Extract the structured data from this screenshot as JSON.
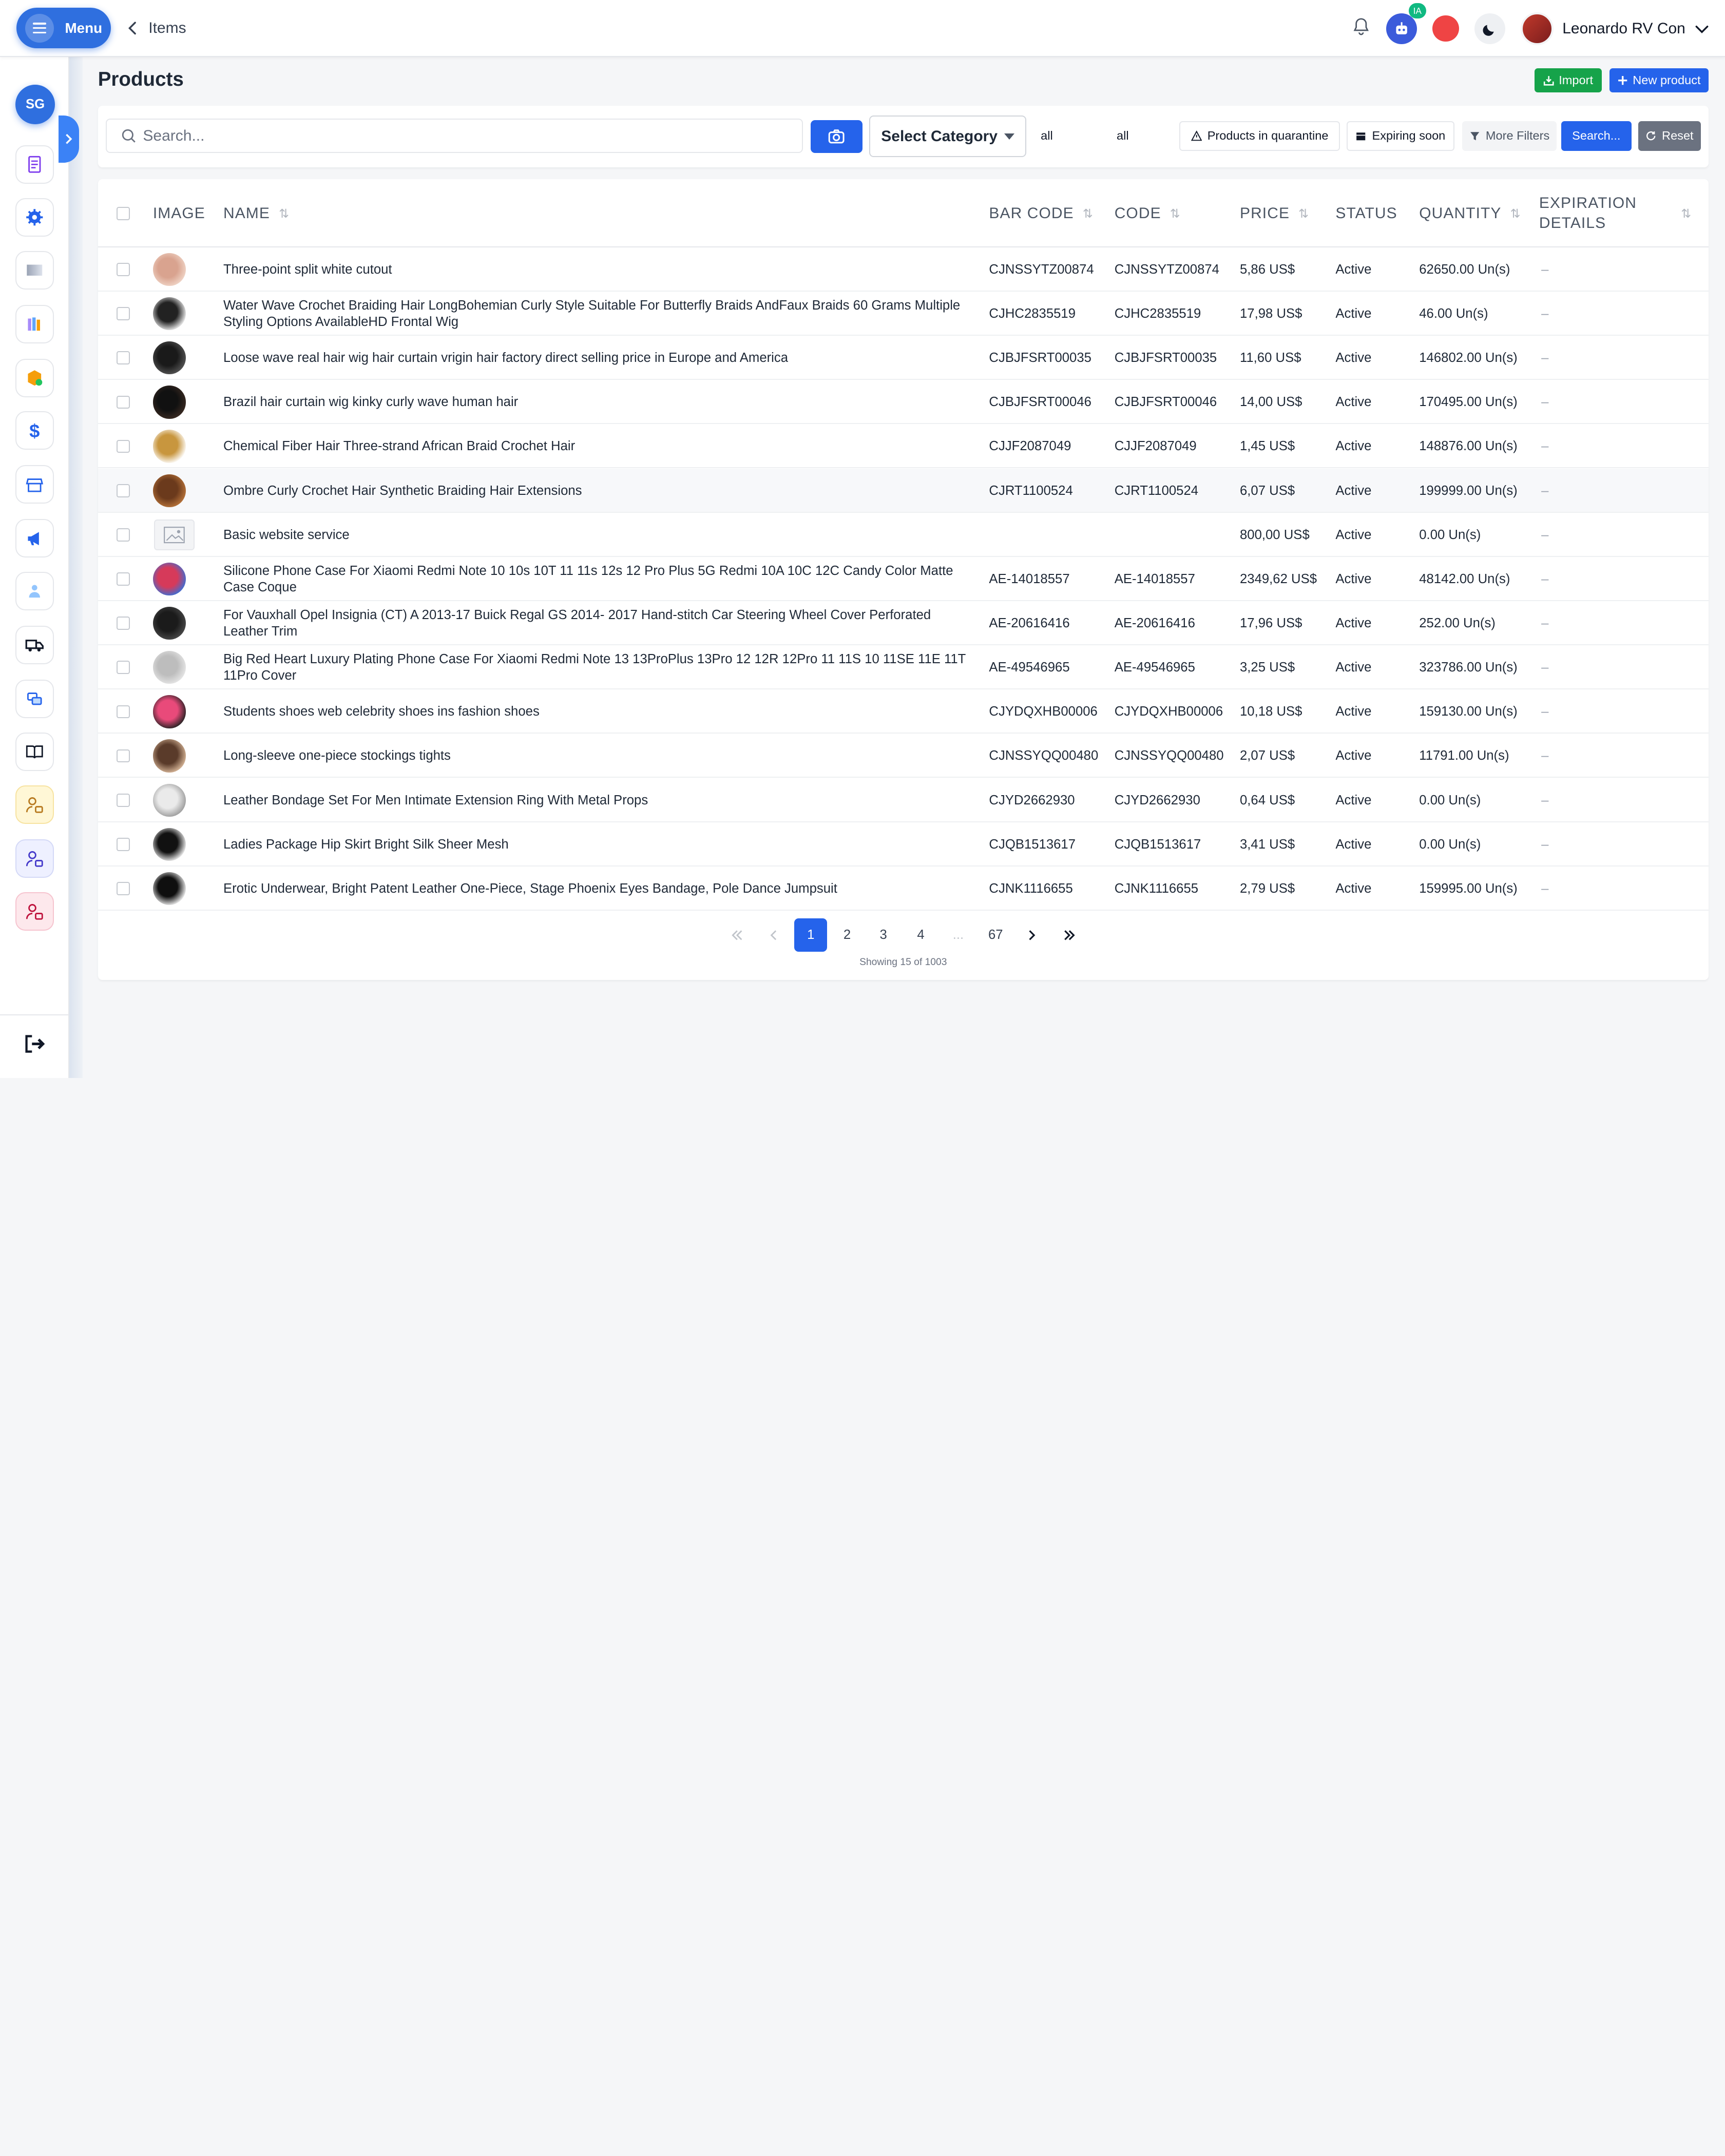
{
  "header": {
    "menu_label": "Menu",
    "back_label": "Items",
    "ia_badge": "IA",
    "user_name": "Leonardo RV Con"
  },
  "sidebar": {
    "org_initials": "SG",
    "items": [
      {
        "icon": "receipt-icon"
      },
      {
        "icon": "gear-icon"
      },
      {
        "icon": "gradient-card-icon"
      },
      {
        "icon": "books-icon"
      },
      {
        "icon": "package-icon"
      },
      {
        "icon": "dollar-icon"
      },
      {
        "icon": "store-icon"
      },
      {
        "icon": "megaphone-icon"
      },
      {
        "icon": "team-icon"
      },
      {
        "icon": "truck-icon"
      },
      {
        "icon": "chat-icon"
      },
      {
        "icon": "book-open-icon"
      },
      {
        "icon": "user-lock-yellow-icon"
      },
      {
        "icon": "user-lock-violet-icon"
      },
      {
        "icon": "user-lock-pink-icon"
      }
    ]
  },
  "page": {
    "title": "Products",
    "import_label": "Import",
    "new_product_label": "New product"
  },
  "filters": {
    "search_placeholder": "Search...",
    "select_category": "Select Category",
    "all_1": "all",
    "all_2": "all",
    "quarantine": "Products in quarantine",
    "expiring": "Expiring soon",
    "more_filters": "More Filters",
    "search_button": "Search...",
    "reset": "Reset"
  },
  "table": {
    "headers": {
      "image": "IMAGE",
      "name": "NAME",
      "barcode": "BAR CODE",
      "code": "CODE",
      "price": "PRICE",
      "status": "STATUS",
      "quantity": "QUANTITY",
      "expiration_1": "EXPIRATION",
      "expiration_2": "DETAILS"
    },
    "rows": [
      {
        "name": "Three-point split white cutout",
        "barcode": "CJNSSYTZ00874",
        "code": "CJNSSYTZ00874",
        "price": "5,86 US$",
        "status": "Active",
        "quantity": "62650.00 Un(s)",
        "expiration": "–",
        "thumb": [
          "#d9a38f",
          "#f0d5c7"
        ]
      },
      {
        "name": "Water Wave Crochet Braiding Hair LongBohemian Curly Style Suitable For Butterfly Braids AndFaux Braids 60 Grams Multiple Styling Options AvailableHD Frontal Wig",
        "barcode": "CJHC2835519",
        "code": "CJHC2835519",
        "price": "17,98 US$",
        "status": "Active",
        "quantity": "46.00 Un(s)",
        "expiration": "–",
        "thumb": [
          "#222222",
          "#f3f3f3"
        ]
      },
      {
        "name": "Loose wave real hair wig hair curtain vrigin hair factory direct selling price in Europe and America",
        "barcode": "CJBJFSRT00035",
        "code": "CJBJFSRT00035",
        "price": "11,60 US$",
        "status": "Active",
        "quantity": "146802.00 Un(s)",
        "expiration": "–",
        "thumb": [
          "#1a1a1a",
          "#555555"
        ]
      },
      {
        "name": "Brazil hair curtain wig kinky curly wave human hair",
        "barcode": "CJBJFSRT00046",
        "code": "CJBJFSRT00046",
        "price": "14,00 US$",
        "status": "Active",
        "quantity": "170495.00 Un(s)",
        "expiration": "–",
        "thumb": [
          "#111111",
          "#3a2a22"
        ]
      },
      {
        "name": "Chemical Fiber Hair Three-strand African Braid Crochet Hair",
        "barcode": "CJJF2087049",
        "code": "CJJF2087049",
        "price": "1,45 US$",
        "status": "Active",
        "quantity": "148876.00 Un(s)",
        "expiration": "–",
        "thumb": [
          "#c8963e",
          "#ffffff"
        ]
      },
      {
        "name": "Ombre Curly Crochet Hair Synthetic Braiding Hair Extensions",
        "barcode": "CJRT1100524",
        "code": "CJRT1100524",
        "price": "6,07 US$",
        "status": "Active",
        "quantity": "199999.00 Un(s)",
        "expiration": "–",
        "thumb": [
          "#6b3a1c",
          "#b8743a"
        ]
      },
      {
        "name": "Basic website service",
        "barcode": "",
        "code": "",
        "price": "800,00 US$",
        "status": "Active",
        "quantity": "0.00 Un(s)",
        "expiration": "–",
        "thumb": null
      },
      {
        "name": "Silicone Phone Case For Xiaomi Redmi Note 10 10s 10T 11 11s 12s 12 Pro Plus 5G Redmi 10A 10C 12C Candy Color Matte Case Coque",
        "barcode": "AE-14018557",
        "code": "AE-14018557",
        "price": "2349,62 US$",
        "status": "Active",
        "quantity": "48142.00 Un(s)",
        "expiration": "–",
        "thumb": [
          "#d63a5a",
          "#3a6fd6"
        ]
      },
      {
        "name": "For Vauxhall Opel Insignia (CT) A 2013-17 Buick Regal GS 2014- 2017 Hand-stitch Car Steering Wheel Cover Perforated Leather Trim",
        "barcode": "AE-20616416",
        "code": "AE-20616416",
        "price": "17,96 US$",
        "status": "Active",
        "quantity": "252.00 Un(s)",
        "expiration": "–",
        "thumb": [
          "#1b1b1b",
          "#4a4a4a"
        ]
      },
      {
        "name": "Big Red Heart Luxury Plating Phone Case For Xiaomi Redmi Note 13 13ProPlus 13Pro 12 12R 12Pro 11 11S 10 11SE 11E 11T 11Pro Cover",
        "barcode": "AE-49546965",
        "code": "AE-49546965",
        "price": "3,25 US$",
        "status": "Active",
        "quantity": "323786.00 Un(s)",
        "expiration": "–",
        "thumb": [
          "#bdbdbd",
          "#e6e6e6"
        ]
      },
      {
        "name": "Students shoes web celebrity shoes ins fashion shoes",
        "barcode": "CJYDQXHB00006",
        "code": "CJYDQXHB00006",
        "price": "10,18 US$",
        "status": "Active",
        "quantity": "159130.00 Un(s)",
        "expiration": "–",
        "thumb": [
          "#e94a7a",
          "#222222"
        ]
      },
      {
        "name": "Long-sleeve one-piece stockings tights",
        "barcode": "CJNSSYQQ00480",
        "code": "CJNSSYQQ00480",
        "price": "2,07 US$",
        "status": "Active",
        "quantity": "11791.00 Un(s)",
        "expiration": "–",
        "thumb": [
          "#5a3b2a",
          "#d9b89a"
        ]
      },
      {
        "name": "Leather Bondage Set For Men Intimate Extension Ring With Metal Props",
        "barcode": "CJYD2662930",
        "code": "CJYD2662930",
        "price": "0,64 US$",
        "status": "Active",
        "quantity": "0.00 Un(s)",
        "expiration": "–",
        "thumb": [
          "#eaeaea",
          "#9a9a9a"
        ]
      },
      {
        "name": "Ladies Package Hip Skirt Bright Silk Sheer Mesh",
        "barcode": "CJQB1513617",
        "code": "CJQB1513617",
        "price": "3,41 US$",
        "status": "Active",
        "quantity": "0.00 Un(s)",
        "expiration": "–",
        "thumb": [
          "#111111",
          "#f5f5f5"
        ]
      },
      {
        "name": "Erotic Underwear, Bright Patent Leather One-Piece, Stage Phoenix Eyes Bandage, Pole Dance Jumpsuit",
        "barcode": "CJNK1116655",
        "code": "CJNK1116655",
        "price": "2,79 US$",
        "status": "Active",
        "quantity": "159995.00 Un(s)",
        "expiration": "–",
        "thumb": [
          "#0f0f0f",
          "#f7f7f7"
        ]
      }
    ]
  },
  "pagination": {
    "pages": [
      "1",
      "2",
      "3",
      "4",
      "...",
      "67"
    ],
    "current": "1",
    "showing": "Showing 15 of 1003"
  },
  "colors": {
    "primary": "#2563eb",
    "success": "#16a34a",
    "danger": "#ef4444",
    "muted": "#6b7280"
  }
}
